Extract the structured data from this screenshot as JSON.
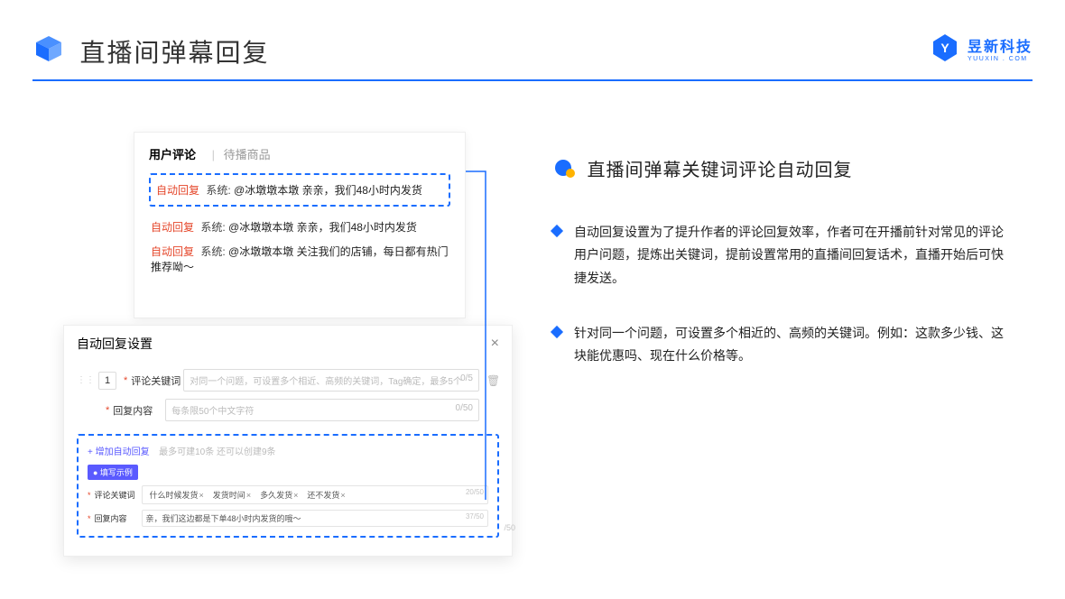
{
  "header": {
    "title": "直播间弹幕回复",
    "brand": "昱新科技",
    "brand_sub": "YUUXIN . COM"
  },
  "panel1": {
    "tab_active": "用户评论",
    "tab_inactive": "待播商品",
    "row_dashed": {
      "tag": "自动回复",
      "sys": "系统:",
      "text": "@冰墩墩本墩 亲亲，我们48小时内发货"
    },
    "row2": {
      "tag": "自动回复",
      "sys": "系统:",
      "text": "@冰墩墩本墩 亲亲，我们48小时内发货"
    },
    "row3": {
      "tag": "自动回复",
      "sys": "系统:",
      "text": "@冰墩墩本墩 关注我们的店铺，每日都有热门推荐呦～"
    }
  },
  "panel2": {
    "title": "自动回复设置",
    "idx": "1",
    "kw_label": "评论关键词",
    "kw_placeholder": "对同一个问题，可设置多个相近、高频的关键词，Tag确定，最多5个",
    "kw_count": "0/5",
    "content_label": "回复内容",
    "content_placeholder": "每条限50个中文字符",
    "content_count": "0/50",
    "add_link": "+ 增加自动回复",
    "add_sub": "最多可建10条 还可以创建9条",
    "example_badge": "● 填写示例",
    "ex_kw_label": "评论关键词",
    "ex_tags": [
      "什么时候发货",
      "发货时间",
      "多久发货",
      "还不发货"
    ],
    "ex_kw_count": "20/50",
    "ex_content_label": "回复内容",
    "ex_content_text": "亲，我们这边都是下单48小时内发货的哦～",
    "ex_content_count": "37/50",
    "stray_count": "/50"
  },
  "right": {
    "title": "直播间弹幕关键词评论自动回复",
    "bullets": [
      "自动回复设置为了提升作者的评论回复效率，作者可在开播前针对常见的评论用户问题，提炼出关键词，提前设置常用的直播间回复话术，直播开始后可快捷发送。",
      "针对同一个问题，可设置多个相近的、高频的关键词。例如：这款多少钱、这块能优惠吗、现在什么价格等。"
    ]
  }
}
